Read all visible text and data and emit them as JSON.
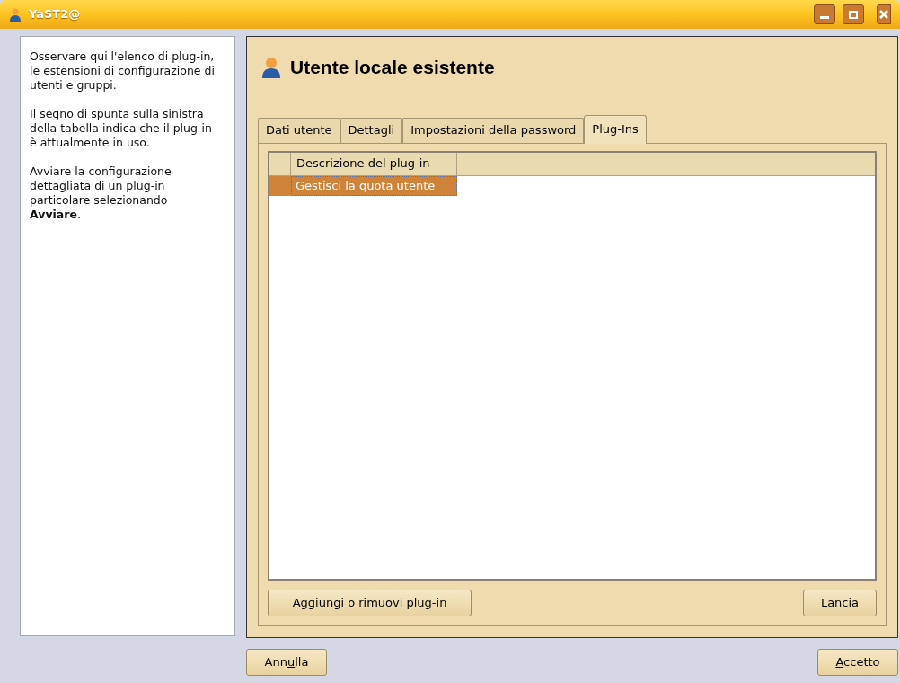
{
  "window": {
    "title": "YaST2@"
  },
  "help": {
    "paragraphs": [
      "Osservare qui l'elenco di plug-in, le estensioni di configurazione di utenti e gruppi.",
      "Il segno di spunta sulla sinistra della tabella indica che il plug-in è attualmente in uso.",
      "Avviare la configurazione dettagliata di un plug-in particolare selezionando **Avviare**."
    ]
  },
  "heading": "Utente locale esistente",
  "tabs": [
    {
      "label": "Dati utente",
      "selected": false
    },
    {
      "label": "Dettagli",
      "selected": false
    },
    {
      "label": "Impostazioni della password",
      "selected": false
    },
    {
      "label": "Plug-Ins",
      "selected": true
    }
  ],
  "table": {
    "columns": [
      "Descrizione del plug-in"
    ],
    "rows": [
      {
        "checked": false,
        "description": "Gestisci la quota utente",
        "selected": true
      }
    ]
  },
  "panel_buttons": [
    {
      "before": "A",
      "access_key": "g",
      "after": "giungi o rimuovi plug-in"
    },
    {
      "access_key": "L",
      "after": "ancia"
    }
  ],
  "dialog_buttons": [
    {
      "before": "Ann",
      "access_key": "u",
      "after": "lla"
    },
    {
      "access_key": "A",
      "after": "ccetto"
    }
  ]
}
